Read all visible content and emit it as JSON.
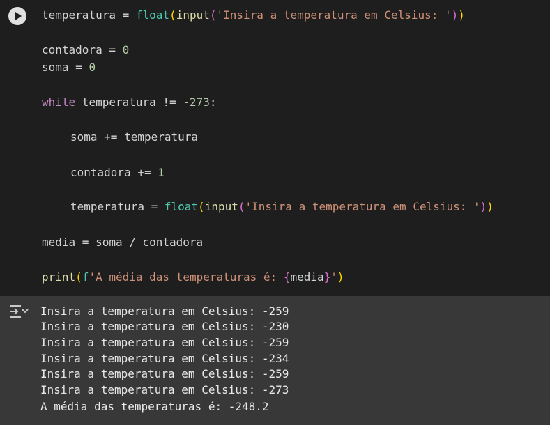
{
  "code": {
    "line1": {
      "var": "temperatura",
      "eq": " = ",
      "fn_float": "float",
      "open1": "(",
      "fn_input": "input",
      "open2": "(",
      "str": "'Insira a temperatura em Celsius: '",
      "close2": ")",
      "close1": ")"
    },
    "line2": {
      "var": "contadora",
      "eq": " = ",
      "num": "0"
    },
    "line3": {
      "var": "soma",
      "eq": " = ",
      "num": "0"
    },
    "line4": {
      "kw": "while",
      "rest": " temperatura != ",
      "num": "-273",
      "colon": ":"
    },
    "line5": {
      "text": "soma += temperatura"
    },
    "line6": {
      "text": "contadora += ",
      "num": "1"
    },
    "line7": {
      "var": "temperatura",
      "eq": " = ",
      "fn_float": "float",
      "open1": "(",
      "fn_input": "input",
      "open2": "(",
      "str": "'Insira a temperatura em Celsius: '",
      "close2": ")",
      "close1": ")"
    },
    "line8": {
      "text": "media = soma / contadora"
    },
    "line9": {
      "fn_print": "print",
      "open1": "(",
      "fprefix": "f",
      "str_a": "'A média das temperaturas é: ",
      "brace_open": "{",
      "expr": "media",
      "brace_close": "}",
      "str_b": "'",
      "close1": ")"
    }
  },
  "output": {
    "lines": [
      "Insira a temperatura em Celsius: -259",
      "Insira a temperatura em Celsius: -230",
      "Insira a temperatura em Celsius: -259",
      "Insira a temperatura em Celsius: -234",
      "Insira a temperatura em Celsius: -259",
      "Insira a temperatura em Celsius: -273",
      "A média das temperaturas é: -248.2"
    ]
  },
  "icons": {
    "run": "play-icon",
    "output": "output-menu-icon"
  },
  "colors": {
    "code_bg": "#1e1e1e",
    "output_bg": "#383838",
    "keyword": "#c586c0",
    "function": "#dcdcaa",
    "builtin": "#4ec9b0",
    "number": "#b5cea8",
    "string": "#ce9178"
  }
}
